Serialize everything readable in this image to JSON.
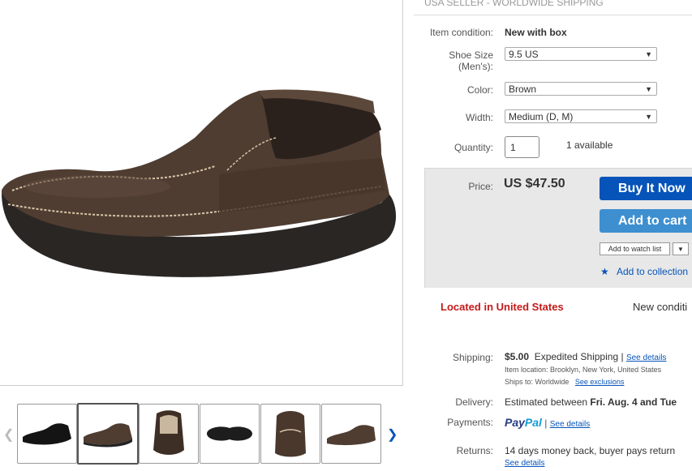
{
  "header": {
    "banner": "USA SELLER - WORLDWIDE SHIPPING"
  },
  "form": {
    "condition_label": "Item condition:",
    "condition_value": "New with box",
    "size_label_1": "Shoe Size",
    "size_label_2": "(Men's):",
    "size_value": "9.5 US",
    "color_label": "Color:",
    "color_value": "Brown",
    "width_label": "Width:",
    "width_value": "Medium (D, M)",
    "quantity_label": "Quantity:",
    "quantity_value": "1",
    "available": "1 available"
  },
  "price": {
    "label": "Price:",
    "value": "US $47.50",
    "buy_now": "Buy It Now",
    "add_to_cart": "Add to cart",
    "watch_list": "Add to watch list",
    "add_collection": "Add to collection",
    "located": "Located in United States",
    "new_condition": "New conditi"
  },
  "shipping": {
    "label": "Shipping:",
    "cost": "$5.00",
    "method": "Expedited Shipping",
    "separator": "|",
    "see_details": "See details",
    "item_location": "Item location:  Brooklyn, New York, United States",
    "ships_to": "Ships to:  Worldwide",
    "see_exclusions": "See exclusions"
  },
  "delivery": {
    "label": "Delivery:",
    "prefix": "Estimated between ",
    "dates": "Fri. Aug. 4 and Tue"
  },
  "payments": {
    "label": "Payments:",
    "paypal_pay": "Pay",
    "paypal_pal": "Pal",
    "separator": "|",
    "see_details": "See details"
  },
  "returns": {
    "label": "Returns:",
    "text": "14 days money back, buyer pays return",
    "see_details": "See details"
  },
  "colors": {
    "buy_now": "#0654ba",
    "add_to_cart": "#3d8fd0",
    "located_red": "#c51a1a",
    "paypal_dark": "#253b80",
    "paypal_light": "#179bd7"
  }
}
